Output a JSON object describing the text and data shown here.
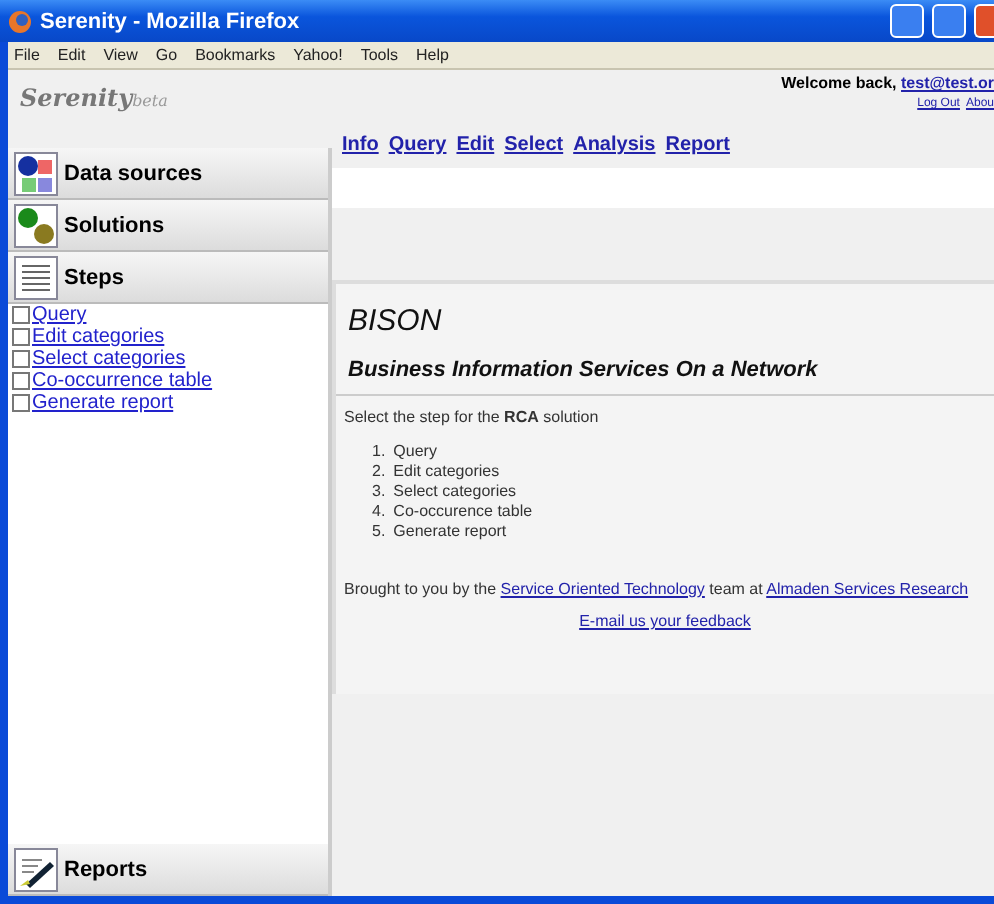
{
  "window": {
    "title": "Serenity - Mozilla Firefox"
  },
  "menu_bar": [
    "File",
    "Edit",
    "View",
    "Go",
    "Bookmarks",
    "Yahoo!",
    "Tools",
    "Help"
  ],
  "header": {
    "logo": "Serenity",
    "logo_suffix": "beta",
    "welcome": "Welcome back,",
    "user": "test@test.or",
    "links": [
      "Log Out",
      "Abou"
    ]
  },
  "sidebar": {
    "panels": [
      {
        "label": "Data sources",
        "kind": "data"
      },
      {
        "label": "Solutions",
        "kind": "solutions"
      },
      {
        "label": "Steps",
        "kind": "steps"
      }
    ],
    "steps": [
      {
        "label": "Query",
        "checked": false
      },
      {
        "label": "Edit categories",
        "checked": false
      },
      {
        "label": "Select categories",
        "checked": false
      },
      {
        "label": "Co-occurrence table",
        "checked": false
      },
      {
        "label": "Generate report",
        "checked": false
      }
    ],
    "bottom_panel": {
      "label": "Reports",
      "kind": "reports"
    }
  },
  "nav_links": [
    "Info",
    "Query",
    "Edit",
    "Select",
    "Analysis",
    "Report"
  ],
  "content": {
    "title": "BISON",
    "subtitle": "Business Information Services On a Network",
    "intro": "Select the step for the **RCA** solution",
    "steps": [
      {
        "number": "1.",
        "label": "Query"
      },
      {
        "number": "2.",
        "label": "Edit categories"
      },
      {
        "number": "3.",
        "label": "Select categories"
      },
      {
        "number": "4.",
        "label": "Co-occurence table"
      },
      {
        "number": "5.",
        "label": "Generate report"
      }
    ],
    "credit": {
      "before": "Brought to you by the",
      "link1": "Service Oriented Technology",
      "middle": "team at",
      "link2": "Almaden Services Research"
    },
    "feedback": "E-mail us your feedback"
  }
}
